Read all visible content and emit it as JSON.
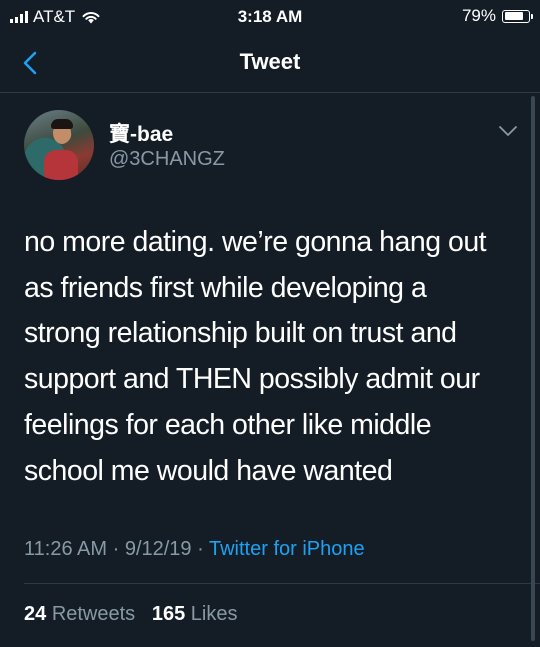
{
  "status_bar": {
    "carrier": "AT&T",
    "time": "3:18 AM",
    "battery_percent": "79%",
    "battery_level": 0.79,
    "icons": [
      "signal-icon",
      "wifi-icon",
      "battery-icon"
    ]
  },
  "nav": {
    "title": "Tweet",
    "back_icon": "chevron-left-icon"
  },
  "tweet": {
    "display_name": "寶-bae",
    "handle": "@3CHANGZ",
    "text": "no more dating. we’re gonna hang out\nas friends first while developing a\nstrong relationship built on trust and\nsupport and THEN possibly admit our\nfeelings for each other like middle\nschool me would have wanted",
    "time": "11:26 AM",
    "date": "9/12/19",
    "separator": "·",
    "source": "Twitter for iPhone",
    "retweets_count": "24",
    "retweets_label": "Retweets",
    "likes_count": "165",
    "likes_label": "Likes"
  },
  "colors": {
    "background": "#141d26",
    "secondary_text": "#8899a6",
    "link": "#1da1f2",
    "divider": "#2c3a47"
  }
}
